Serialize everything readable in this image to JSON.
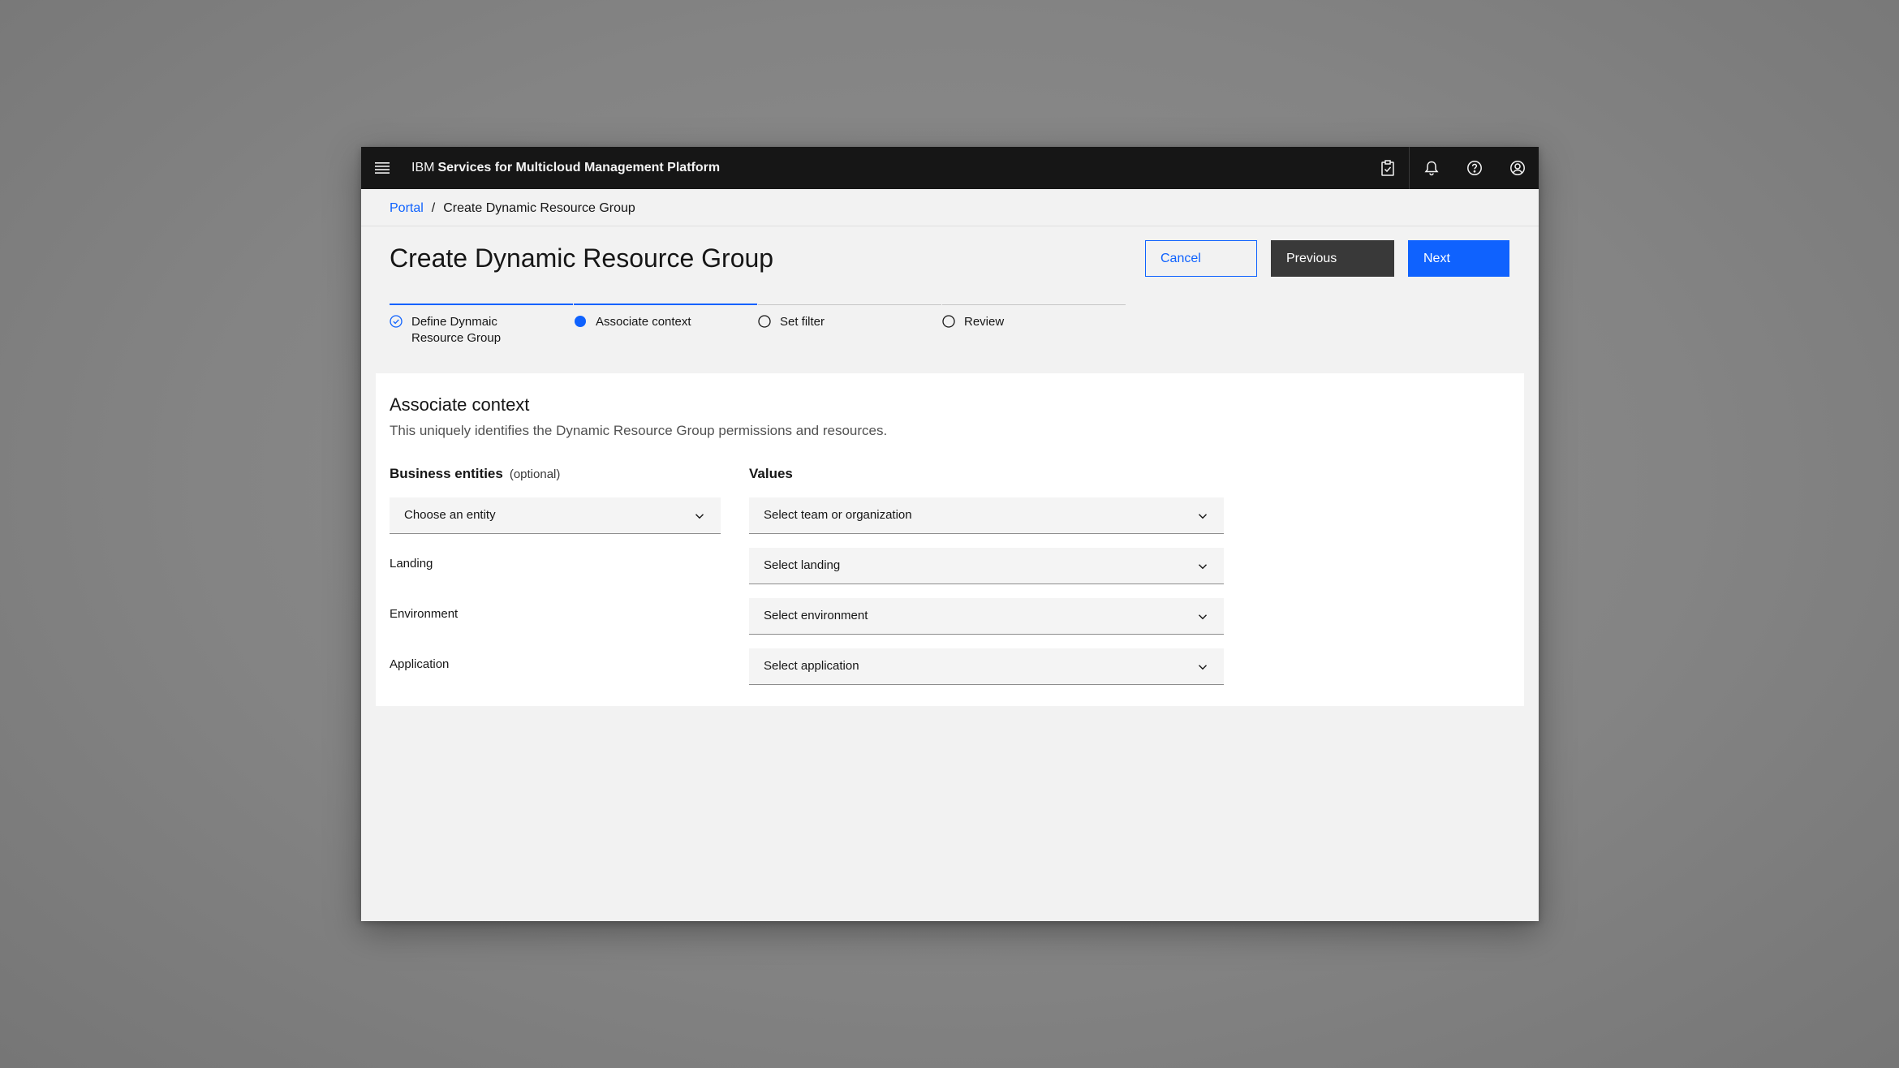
{
  "header": {
    "brand_prefix": "IBM",
    "brand_name": "Services for Multicloud Management Platform",
    "icons": [
      "menu-icon",
      "clipboard-check-icon",
      "notification-icon",
      "help-icon",
      "user-avatar-icon"
    ]
  },
  "breadcrumb": {
    "root": "Portal",
    "separator": "/",
    "current": "Create Dynamic Resource Group"
  },
  "page": {
    "title": "Create Dynamic Resource Group"
  },
  "buttons": {
    "cancel": "Cancel",
    "previous": "Previous",
    "next": "Next"
  },
  "progress": {
    "steps": [
      {
        "label": "Define Dynmaic",
        "label_line2": "Resource Group",
        "state": "complete"
      },
      {
        "label": "Associate context",
        "state": "current"
      },
      {
        "label": "Set filter",
        "state": "incomplete"
      },
      {
        "label": "Review",
        "state": "incomplete"
      }
    ]
  },
  "section": {
    "title": "Associate context",
    "description": "This uniquely identifies the Dynamic Resource Group permissions and resources.",
    "business_entities_label": "Business entities",
    "optional_label": "(optional)",
    "values_label": "Values"
  },
  "form": {
    "entity_dropdown": "Choose an entity",
    "team_dropdown": "Select team or organization",
    "rows": [
      {
        "label": "Landing",
        "dropdown": "Select landing"
      },
      {
        "label": "Environment",
        "dropdown": "Select environment"
      },
      {
        "label": "Application",
        "dropdown": "Select application"
      }
    ]
  },
  "colors": {
    "accent": "#0f62fe",
    "header_bg": "#161616",
    "secondary_button": "#393939",
    "page_bg": "#f2f2f2"
  }
}
